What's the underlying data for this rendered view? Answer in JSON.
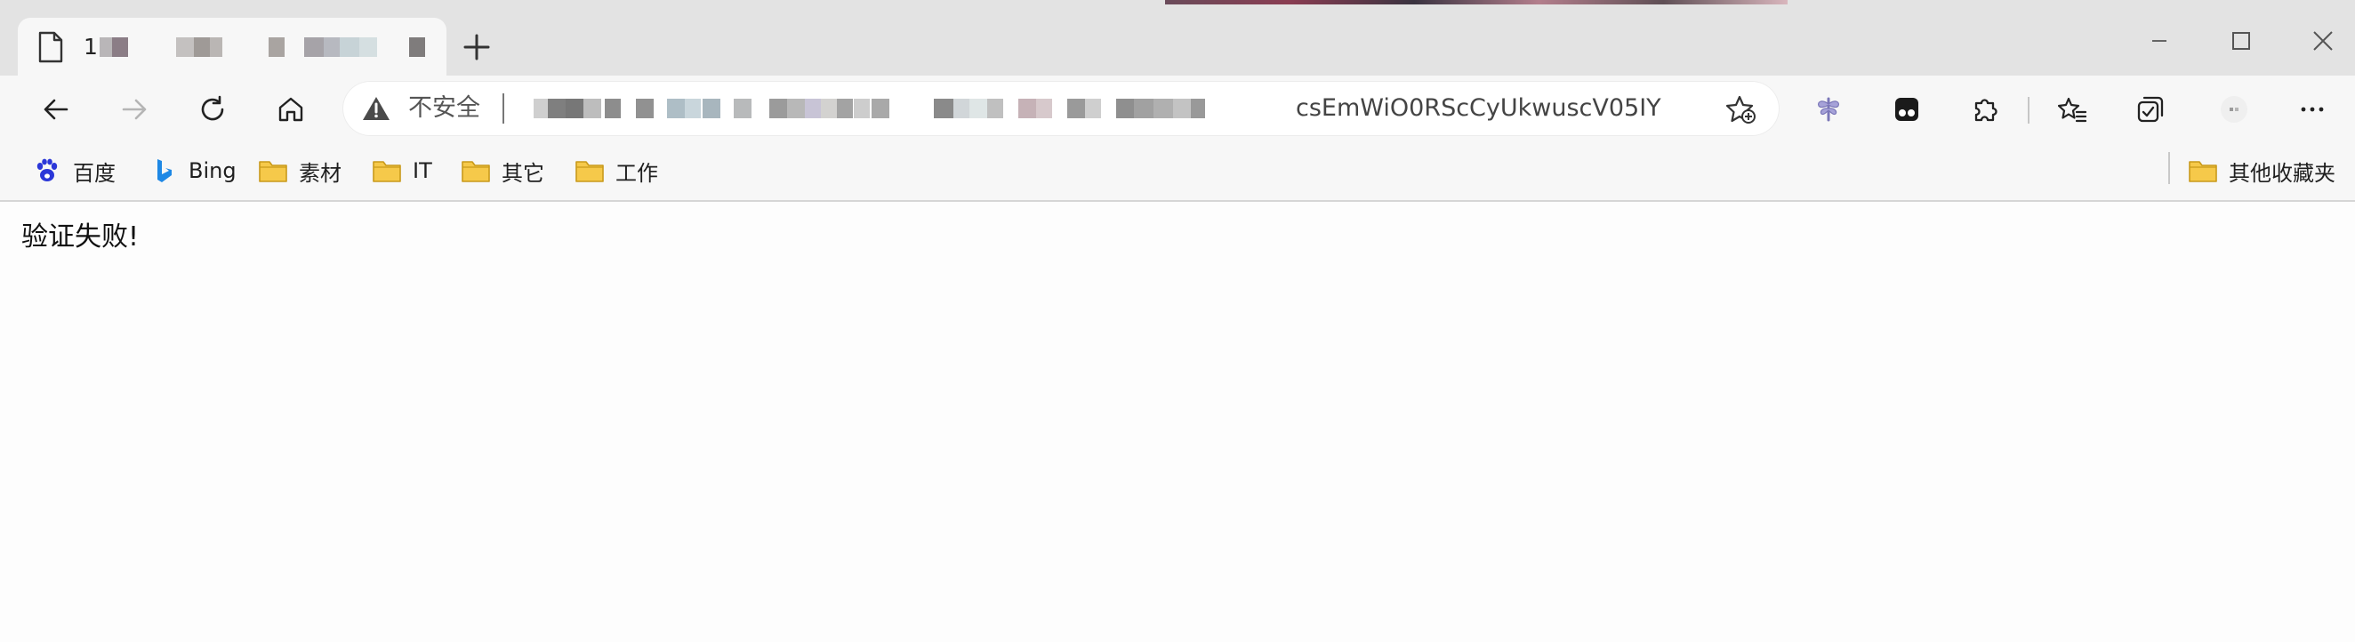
{
  "tab": {
    "title": "1"
  },
  "address": {
    "security_label": "不安全",
    "url_visible_tail": "csEmWiO0RScCyUkwuscV05IY"
  },
  "bookmarks": [
    {
      "name": "baidu",
      "label": "百度",
      "icon": "baidu-paw-icon"
    },
    {
      "name": "bing",
      "label": "Bing",
      "icon": "bing-icon"
    },
    {
      "name": "sucai",
      "label": "素材",
      "icon": "folder-icon"
    },
    {
      "name": "it",
      "label": "IT",
      "icon": "folder-icon"
    },
    {
      "name": "qita",
      "label": "其它",
      "icon": "folder-icon"
    },
    {
      "name": "gongzuo",
      "label": "工作",
      "icon": "folder-icon"
    }
  ],
  "other_favorites": {
    "label": "其他收藏夹",
    "icon": "folder-icon"
  },
  "page": {
    "message": "验证失败!"
  },
  "colors": {
    "folder": "#f6c94a",
    "folder_stroke": "#c99a1b",
    "baidu": "#2b37d8",
    "bing": "#1e88e5"
  }
}
